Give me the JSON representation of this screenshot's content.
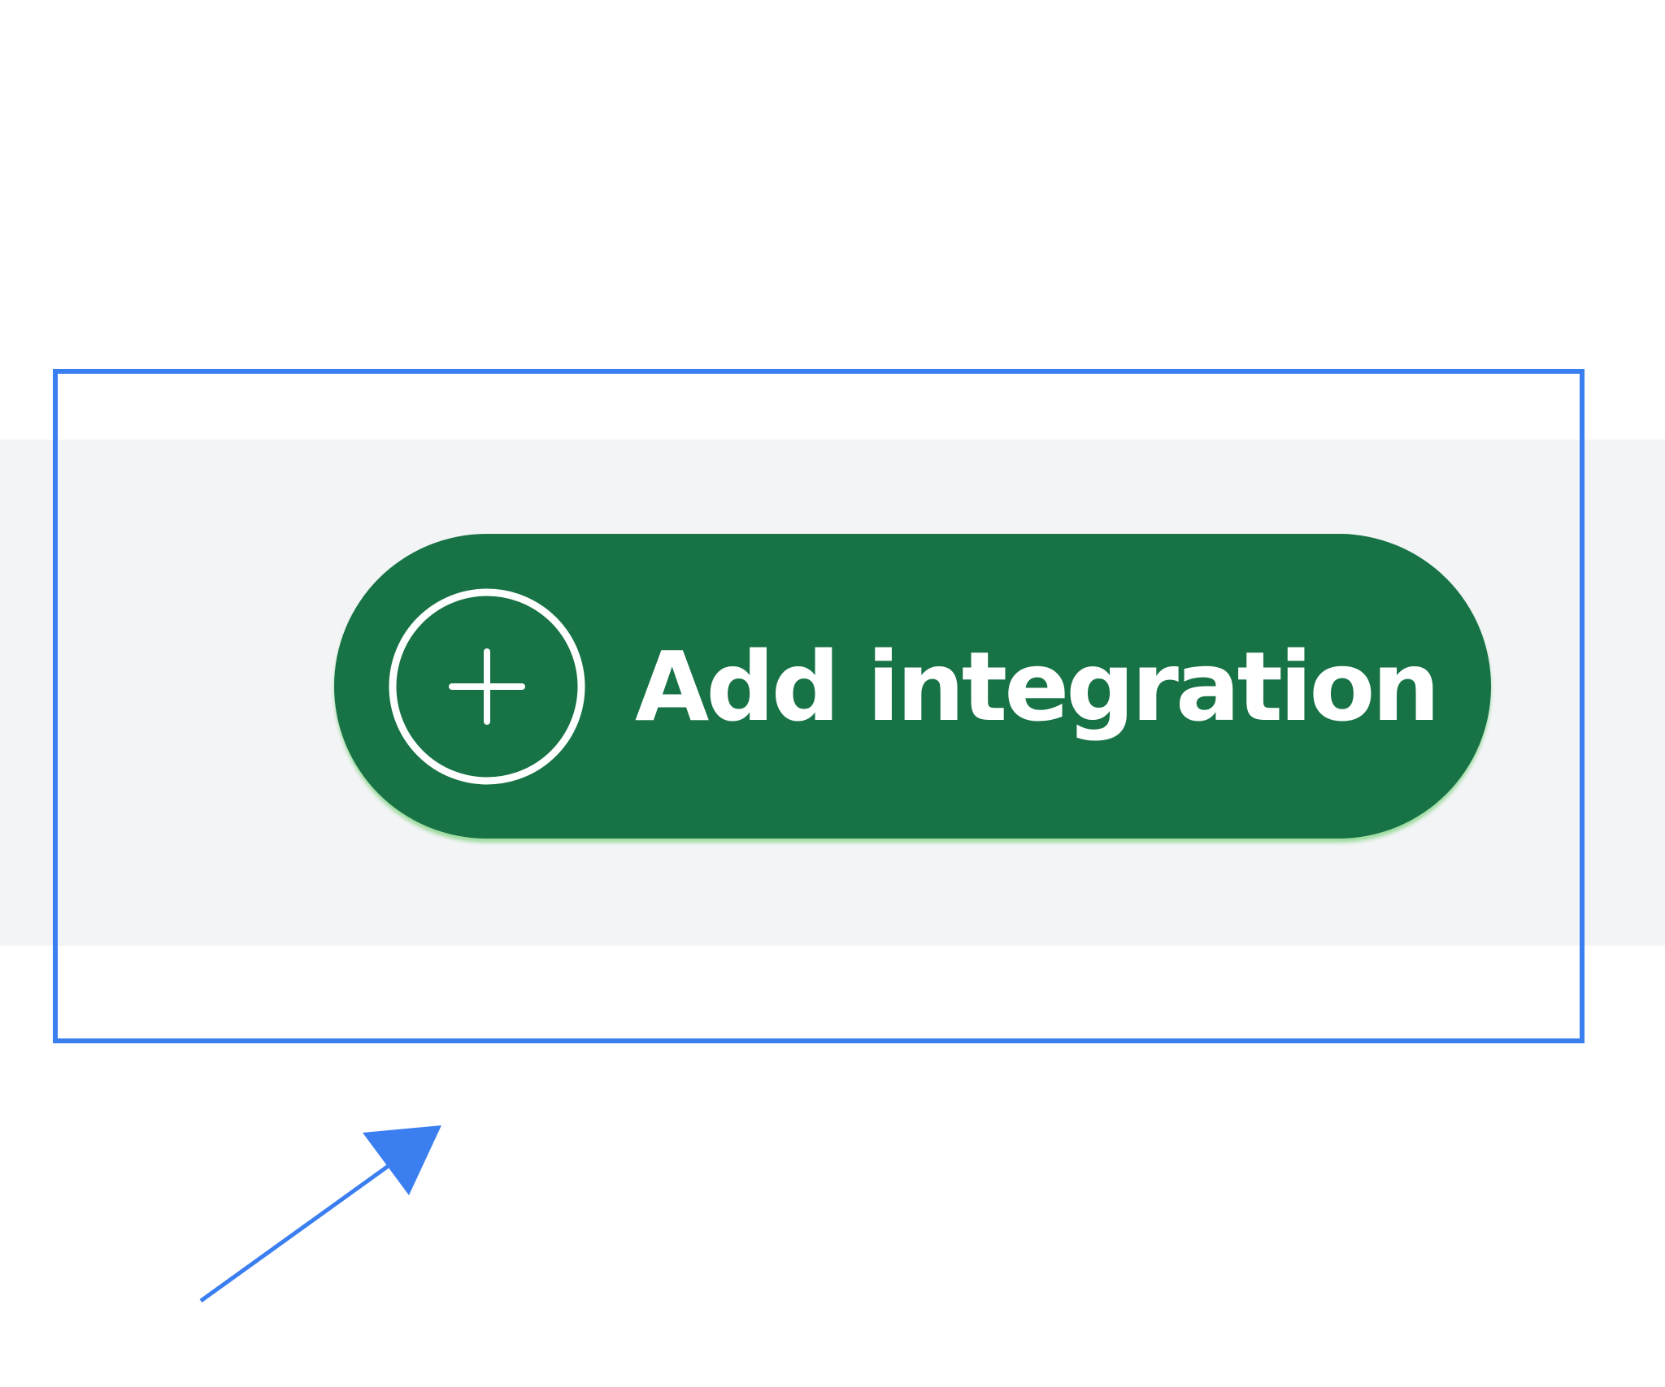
{
  "toolbar": {
    "add_button": {
      "label": "Add integration",
      "icon": "plus-circle-icon",
      "background_color": "#177245",
      "text_color": "#ffffff"
    },
    "strip_color": "#f3f4f6"
  },
  "annotation": {
    "highlight_color": "#3a7ef0",
    "arrow_color": "#3a7ef0"
  }
}
